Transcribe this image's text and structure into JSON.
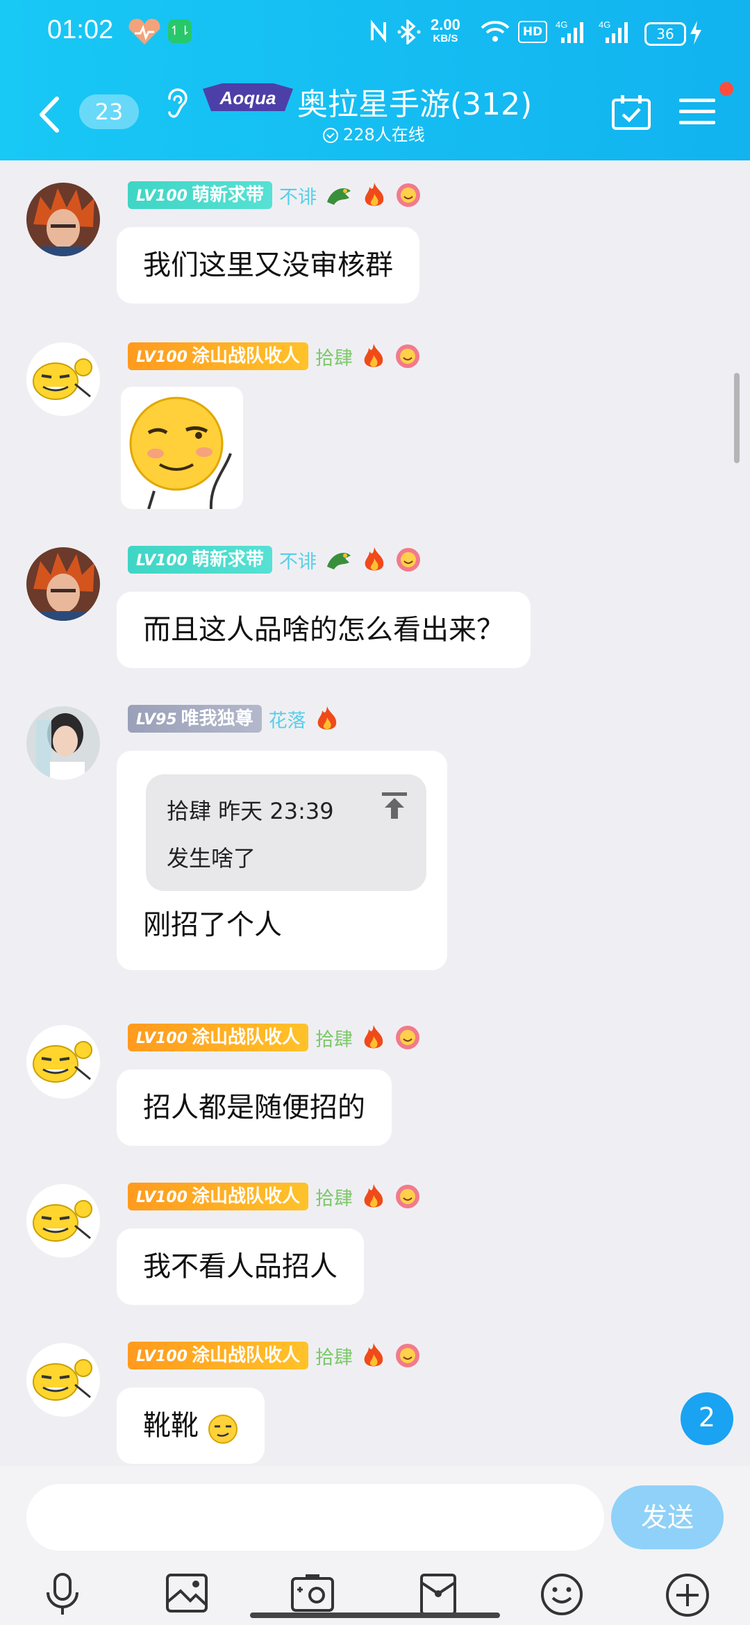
{
  "status_bar": {
    "time": "01:02",
    "net_speed_value": "2.00",
    "net_speed_unit": "KB/S",
    "battery": "36"
  },
  "header": {
    "unread_count": "23",
    "group_title": "奥拉星手游(312)",
    "online_text": "228人在线",
    "logo_text": "Aoqua"
  },
  "messages": [
    {
      "level": "LV100",
      "title": "萌新求带",
      "name": "不诽",
      "text": "我们这里又没审核群"
    },
    {
      "level": "LV100",
      "title": "涂山战队收人",
      "name": "拾肆"
    },
    {
      "level": "LV100",
      "title": "萌新求带",
      "name": "不诽",
      "text": "而且这人品啥的怎么看出来？"
    },
    {
      "level": "LV95",
      "title": "唯我独尊",
      "name": "花落",
      "quote_header": "拾肆 昨天 23:39",
      "quote_text": "发生啥了",
      "text": "刚招了个人"
    },
    {
      "level": "LV100",
      "title": "涂山战队收人",
      "name": "拾肆",
      "text": "招人都是随便招的"
    },
    {
      "level": "LV100",
      "title": "涂山战队收人",
      "name": "拾肆",
      "text": "我不看人品招人"
    },
    {
      "level": "LV100",
      "title": "涂山战队收人",
      "name": "拾肆",
      "text": "靴靴"
    }
  ],
  "new_message_count": "2",
  "composer": {
    "placeholder": "",
    "send_label": "发送"
  },
  "toolbar": [
    "mic-icon",
    "image-icon",
    "camera-icon",
    "red-packet-icon",
    "emoji-icon",
    "plus-icon"
  ],
  "colors": {
    "header_blue": "#14bcf2",
    "teal_title": "#3fd5c5",
    "orange_title": "#ffa91f",
    "gray_title": "#a2a7bd",
    "name_teal": "#56cfe8",
    "name_green": "#7cc86a",
    "badge_blue": "#1aa3f2"
  }
}
